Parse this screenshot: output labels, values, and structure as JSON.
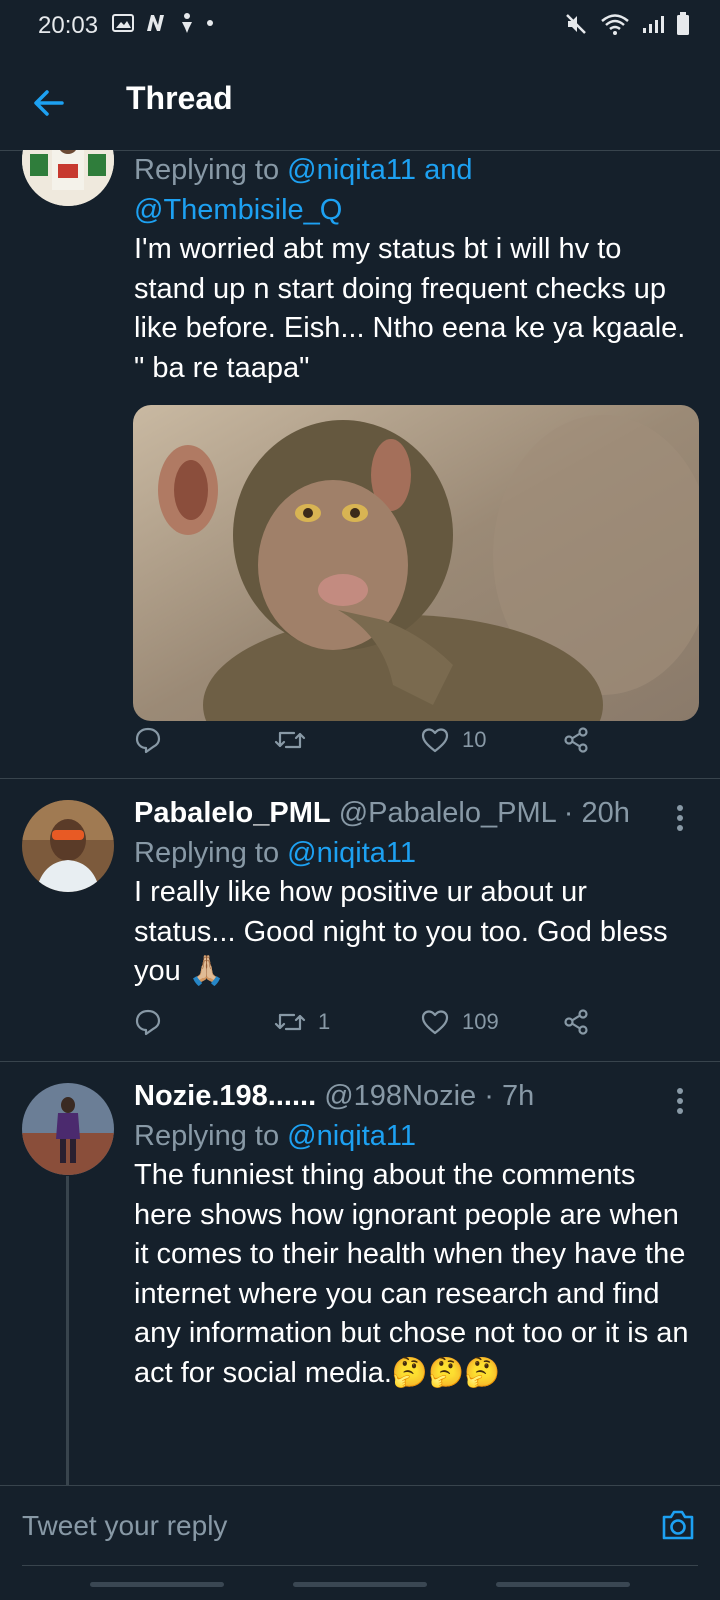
{
  "status_bar": {
    "time": "20:03"
  },
  "header": {
    "title": "Thread"
  },
  "tweets": [
    {
      "replying_prefix": "Replying to",
      "mention1": "@niqita11",
      "and": "and",
      "mention2": "@Thembisile_Q",
      "text": "I'm worried abt my status bt i will hv to stand up n start doing frequent checks up like before. Eish... Ntho eena ke ya kgaale. \" ba re taapa\"",
      "retweets": "",
      "likes": "10"
    },
    {
      "name": "Pabalelo_PML",
      "handle": "@Pabalelo_PML",
      "time": "20h",
      "replying_prefix": "Replying to",
      "mention1": "@niqita11",
      "text": "I really like how positive ur about ur status... Good night to you too. God bless you 🙏🏼",
      "retweets": "1",
      "likes": "109"
    },
    {
      "name": "Nozie.198......",
      "handle": "@198Nozie",
      "time": "7h",
      "replying_prefix": "Replying to",
      "mention1": "@niqita11",
      "text": "The funniest thing about the comments here shows how ignorant people are when it comes to their health when they have the internet where you can research and find any information but chose not too or it is an act for social media.🤔🤔🤔"
    }
  ],
  "composer": {
    "placeholder": "Tweet your reply"
  }
}
